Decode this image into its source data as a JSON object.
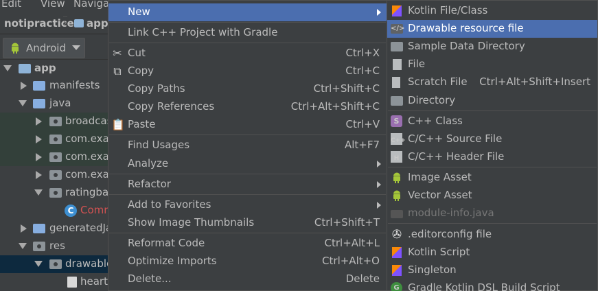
{
  "menubar": {
    "items": [
      "Edit",
      "View",
      "Navigate"
    ]
  },
  "navbar": {
    "project": "notipractice",
    "module": "app"
  },
  "project_view": {
    "selector": "Android"
  },
  "tree": [
    {
      "label": "app",
      "bold": true
    },
    {
      "label": "manifests"
    },
    {
      "label": "java"
    },
    {
      "label": "broadcas"
    },
    {
      "label": "com.exan"
    },
    {
      "label": "com.exan"
    },
    {
      "label": "com.exan"
    },
    {
      "label": "ratingbar"
    },
    {
      "label": "Comr"
    },
    {
      "label": "generatedJa"
    },
    {
      "label": "res"
    },
    {
      "label": "drawable"
    },
    {
      "label": "heart."
    }
  ],
  "context_menu": {
    "new": "New",
    "link_cpp": "Link C++ Project with Gradle",
    "cut": "Cut",
    "cut_sc": "Ctrl+X",
    "copy": "Copy",
    "copy_sc": "Ctrl+C",
    "copy_paths": "Copy Paths",
    "copy_paths_sc": "Ctrl+Shift+C",
    "copy_refs": "Copy References",
    "copy_refs_sc": "Ctrl+Alt+Shift+C",
    "paste": "Paste",
    "paste_sc": "Ctrl+V",
    "find_usages": "Find Usages",
    "find_usages_sc": "Alt+F7",
    "analyze": "Analyze",
    "refactor": "Refactor",
    "add_favorites": "Add to Favorites",
    "show_thumbs": "Show Image Thumbnails",
    "show_thumbs_sc": "Ctrl+Shift+T",
    "reformat": "Reformat Code",
    "reformat_sc": "Ctrl+Alt+L",
    "optimize": "Optimize Imports",
    "optimize_sc": "Ctrl+Alt+O",
    "delete": "Delete...",
    "delete_sc": "Delete"
  },
  "new_submenu": {
    "kotlin_file": "Kotlin File/Class",
    "drawable": "Drawable resource file",
    "sample_data": "Sample Data Directory",
    "file": "File",
    "scratch": "Scratch File",
    "scratch_sc": "Ctrl+Alt+Shift+Insert",
    "directory": "Directory",
    "cpp_class": "C++ Class",
    "cpp_source": "C/C++ Source File",
    "cpp_header": "C/C++ Header File",
    "image_asset": "Image Asset",
    "vector_asset": "Vector Asset",
    "module_info": "module-info.java",
    "editorconfig": ".editorconfig file",
    "kotlin_script": "Kotlin Script",
    "singleton": "Singleton",
    "gradle_kotlin": "Gradle Kotlin DSL Build Script"
  },
  "colors": {
    "highlight": "#4b6eaf",
    "menu_bg": "#3c3f41",
    "text": "#bbbbbb"
  }
}
